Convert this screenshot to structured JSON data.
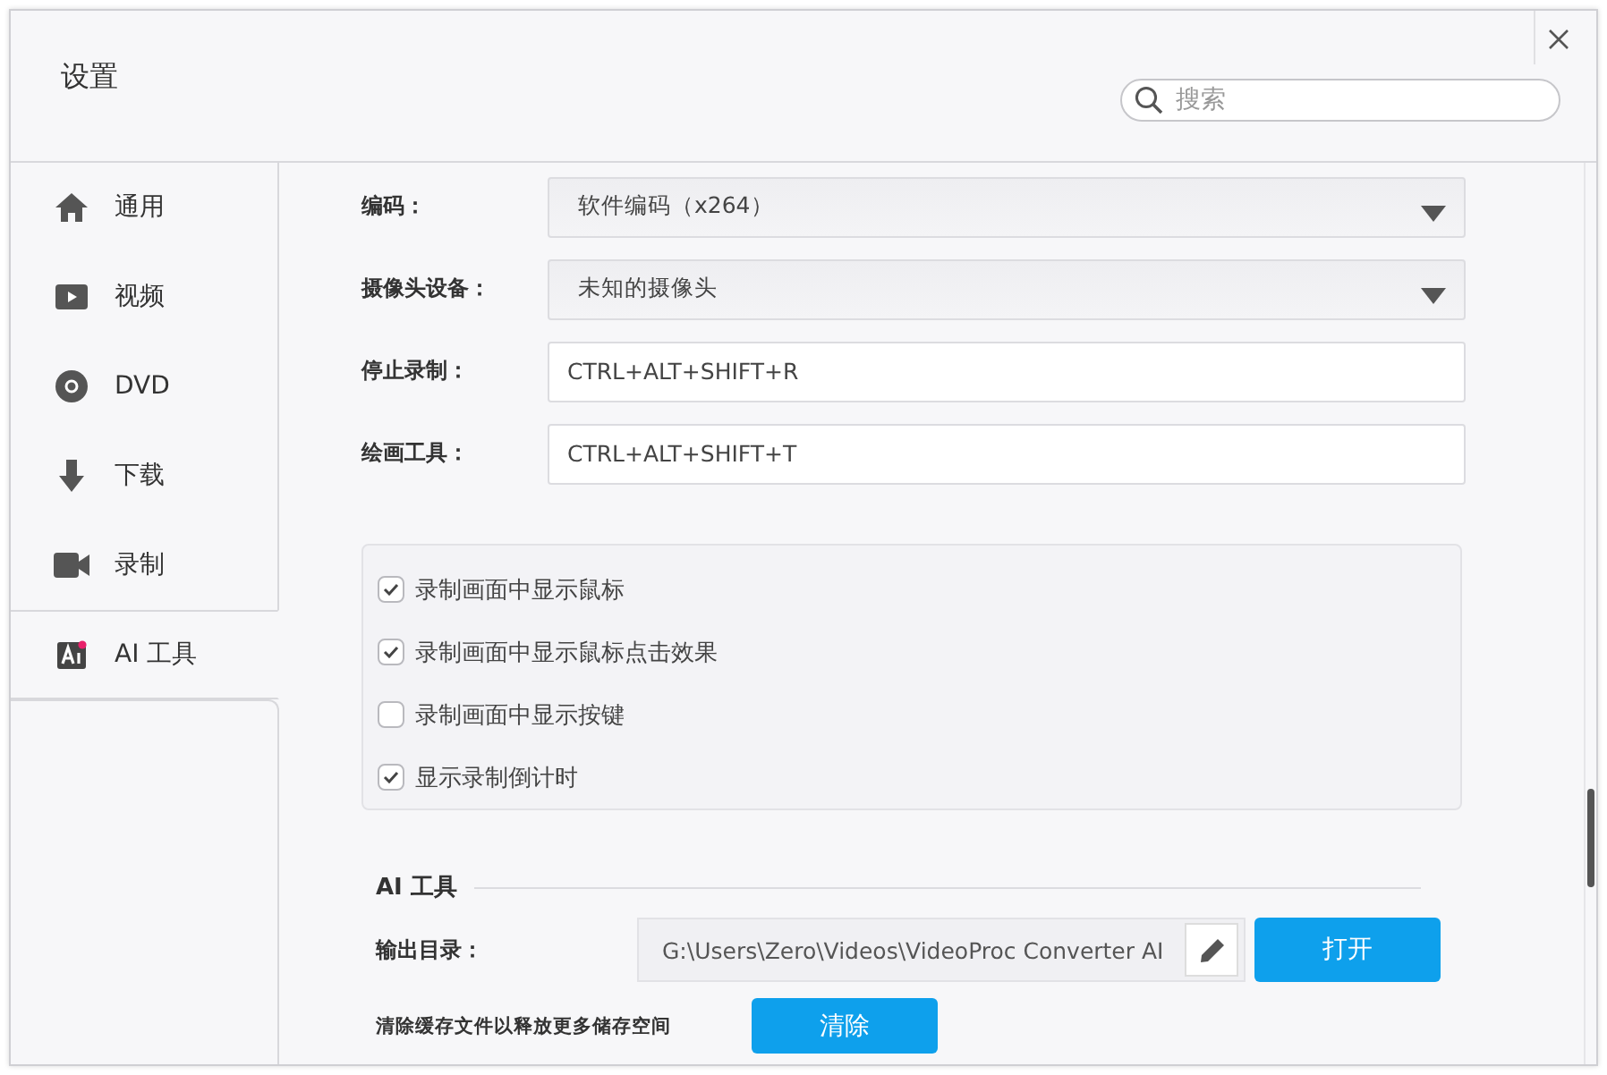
{
  "window": {
    "title": "设置"
  },
  "search": {
    "placeholder": "搜索"
  },
  "sidebar": {
    "items": [
      {
        "label": "通用",
        "selected": false
      },
      {
        "label": "视频",
        "selected": false
      },
      {
        "label": "DVD",
        "selected": false
      },
      {
        "label": "下载",
        "selected": false
      },
      {
        "label": "录制",
        "selected": false
      },
      {
        "label": "AI 工具",
        "selected": true
      }
    ]
  },
  "settings": [
    {
      "label": "编码：",
      "kind": "dropdown",
      "value": "软件编码（x264）"
    },
    {
      "label": "摄像头设备：",
      "kind": "dropdown",
      "value": "未知的摄像头"
    },
    {
      "label": "停止录制：",
      "kind": "text",
      "value": "CTRL+ALT+SHIFT+R"
    },
    {
      "label": "绘画工具：",
      "kind": "text",
      "value": "CTRL+ALT+SHIFT+T"
    }
  ],
  "options": [
    {
      "label": "录制画面中显示鼠标",
      "checked": true
    },
    {
      "label": "录制画面中显示鼠标点击效果",
      "checked": true
    },
    {
      "label": "录制画面中显示按键",
      "checked": false
    },
    {
      "label": "显示录制倒计时",
      "checked": true
    }
  ],
  "ai_tools": {
    "heading": "AI 工具",
    "output_label": "输出目录：",
    "output_path": "G:\\Users\\Zero\\Videos\\VideoProc Converter AI",
    "open_button": "打开",
    "cache_note": "清除缓存文件以释放更多储存空间",
    "clear_button": "清除"
  }
}
